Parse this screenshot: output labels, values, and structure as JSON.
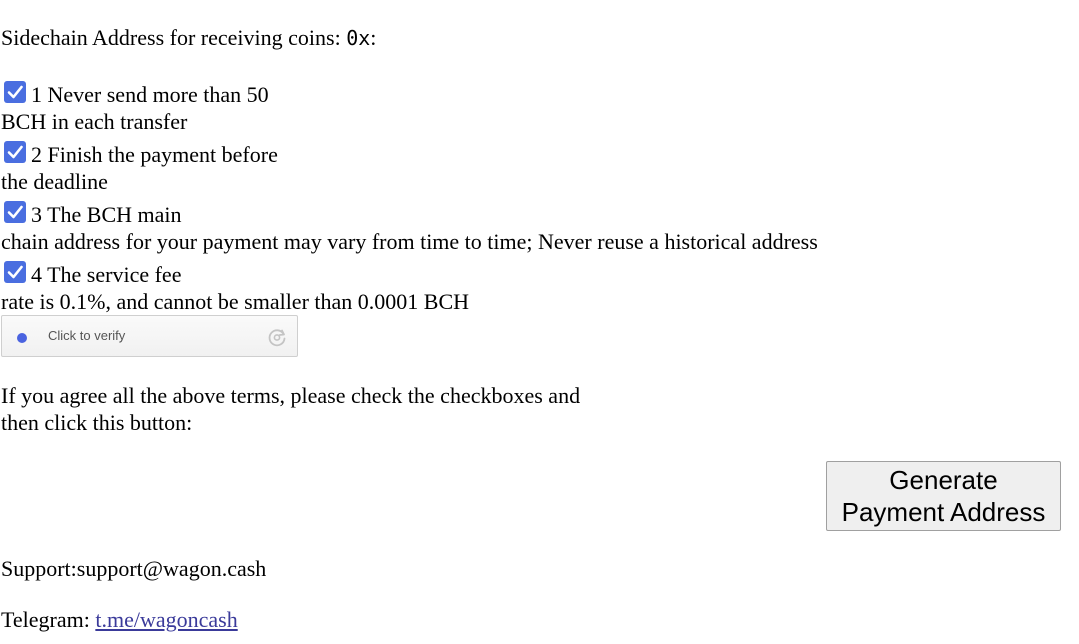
{
  "address": {
    "label": "Sidechain Address for receiving coins: ",
    "value": "0x",
    "suffix": ":"
  },
  "terms": [
    {
      "checked": true,
      "line1": "1 Never send more than 50",
      "line2": "BCH in each transfer"
    },
    {
      "checked": true,
      "line1": "2 Finish the payment before",
      "line2": "the deadline"
    },
    {
      "checked": true,
      "line1": "3 The BCH main",
      "line2": "chain address for your payment may vary from time to time; Never reuse a historical address"
    },
    {
      "checked": true,
      "line1": "4 The service fee",
      "line2": "rate is 0.1%, and cannot be smaller than 0.0001 BCH"
    }
  ],
  "captcha": {
    "label": "Click to verify",
    "dot_color": "#4a63e0",
    "icon": "refresh-icon"
  },
  "instructions": {
    "line1": "If you agree all the above terms, please check the checkboxes and",
    "line2": "then click this button:"
  },
  "generate_button": {
    "line1": "Generate",
    "line2": "Payment Address"
  },
  "support": {
    "text": "Support:support@wagon.cash"
  },
  "telegram": {
    "label": "Telegram: ",
    "link_text": "t.me/wagoncash"
  },
  "colors": {
    "checkbox": "#4a6ee0",
    "link": "#3a3a9a"
  }
}
